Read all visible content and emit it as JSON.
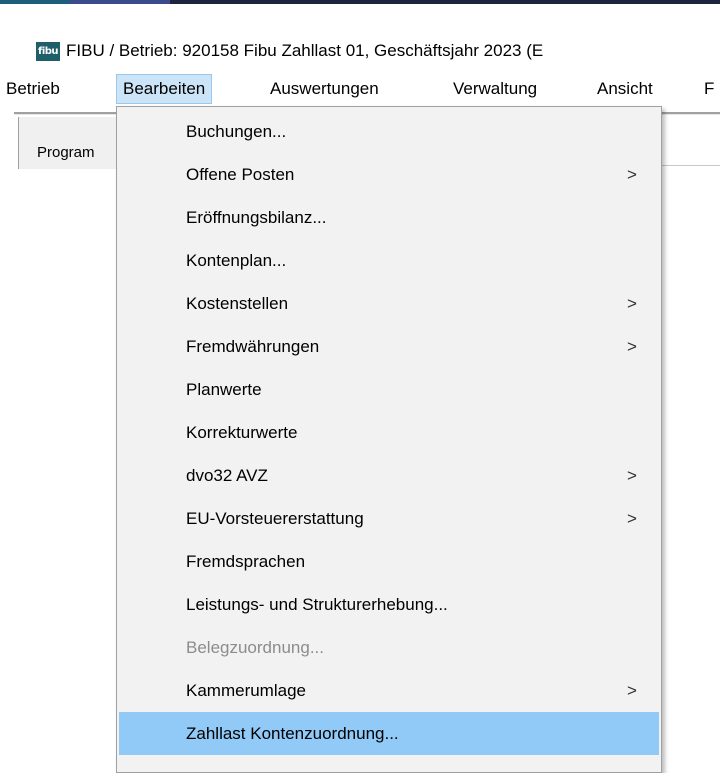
{
  "window": {
    "icon_text": "fibu",
    "title": "FIBU / Betrieb: 920158  Fibu Zahllast 01, Geschäftsjahr 2023 (E"
  },
  "menubar": {
    "items": [
      {
        "label": "Betrieb"
      },
      {
        "label": "Bearbeiten",
        "active": true
      },
      {
        "label": "Auswertungen"
      },
      {
        "label": "Verwaltung"
      },
      {
        "label": "Ansicht"
      },
      {
        "label": "F"
      }
    ]
  },
  "toolbar": {
    "program_label": "Program"
  },
  "dropdown": {
    "submenu_arrow": ">",
    "items": [
      {
        "label": "Buchungen...",
        "submenu": false,
        "disabled": false
      },
      {
        "label": "Offene Posten",
        "submenu": true,
        "disabled": false
      },
      {
        "label": "Eröffnungsbilanz...",
        "submenu": false,
        "disabled": false
      },
      {
        "label": "Kontenplan...",
        "submenu": false,
        "disabled": false
      },
      {
        "label": "Kostenstellen",
        "submenu": true,
        "disabled": false
      },
      {
        "label": "Fremdwährungen",
        "submenu": true,
        "disabled": false
      },
      {
        "label": "Planwerte",
        "submenu": false,
        "disabled": false
      },
      {
        "label": "Korrekturwerte",
        "submenu": false,
        "disabled": false
      },
      {
        "label": "dvo32 AVZ",
        "submenu": true,
        "disabled": false
      },
      {
        "label": "EU-Vorsteuererstattung",
        "submenu": true,
        "disabled": false
      },
      {
        "label": "Fremdsprachen",
        "submenu": false,
        "disabled": false
      },
      {
        "label": "Leistungs- und Strukturerhebung...",
        "submenu": false,
        "disabled": false
      },
      {
        "label": "Belegzuordnung...",
        "submenu": false,
        "disabled": true
      },
      {
        "label": "Kammerumlage",
        "submenu": true,
        "disabled": false
      },
      {
        "label": "Zahllast Kontenzuordnung...",
        "submenu": false,
        "disabled": false,
        "highlighted": true
      }
    ]
  },
  "colors": {
    "menu_background": "#f2f2f2",
    "highlight": "#91c9f7",
    "active_menu": "#cce4f7",
    "disabled_text": "#8c8c8c",
    "app_icon": "#1f5f6a"
  }
}
